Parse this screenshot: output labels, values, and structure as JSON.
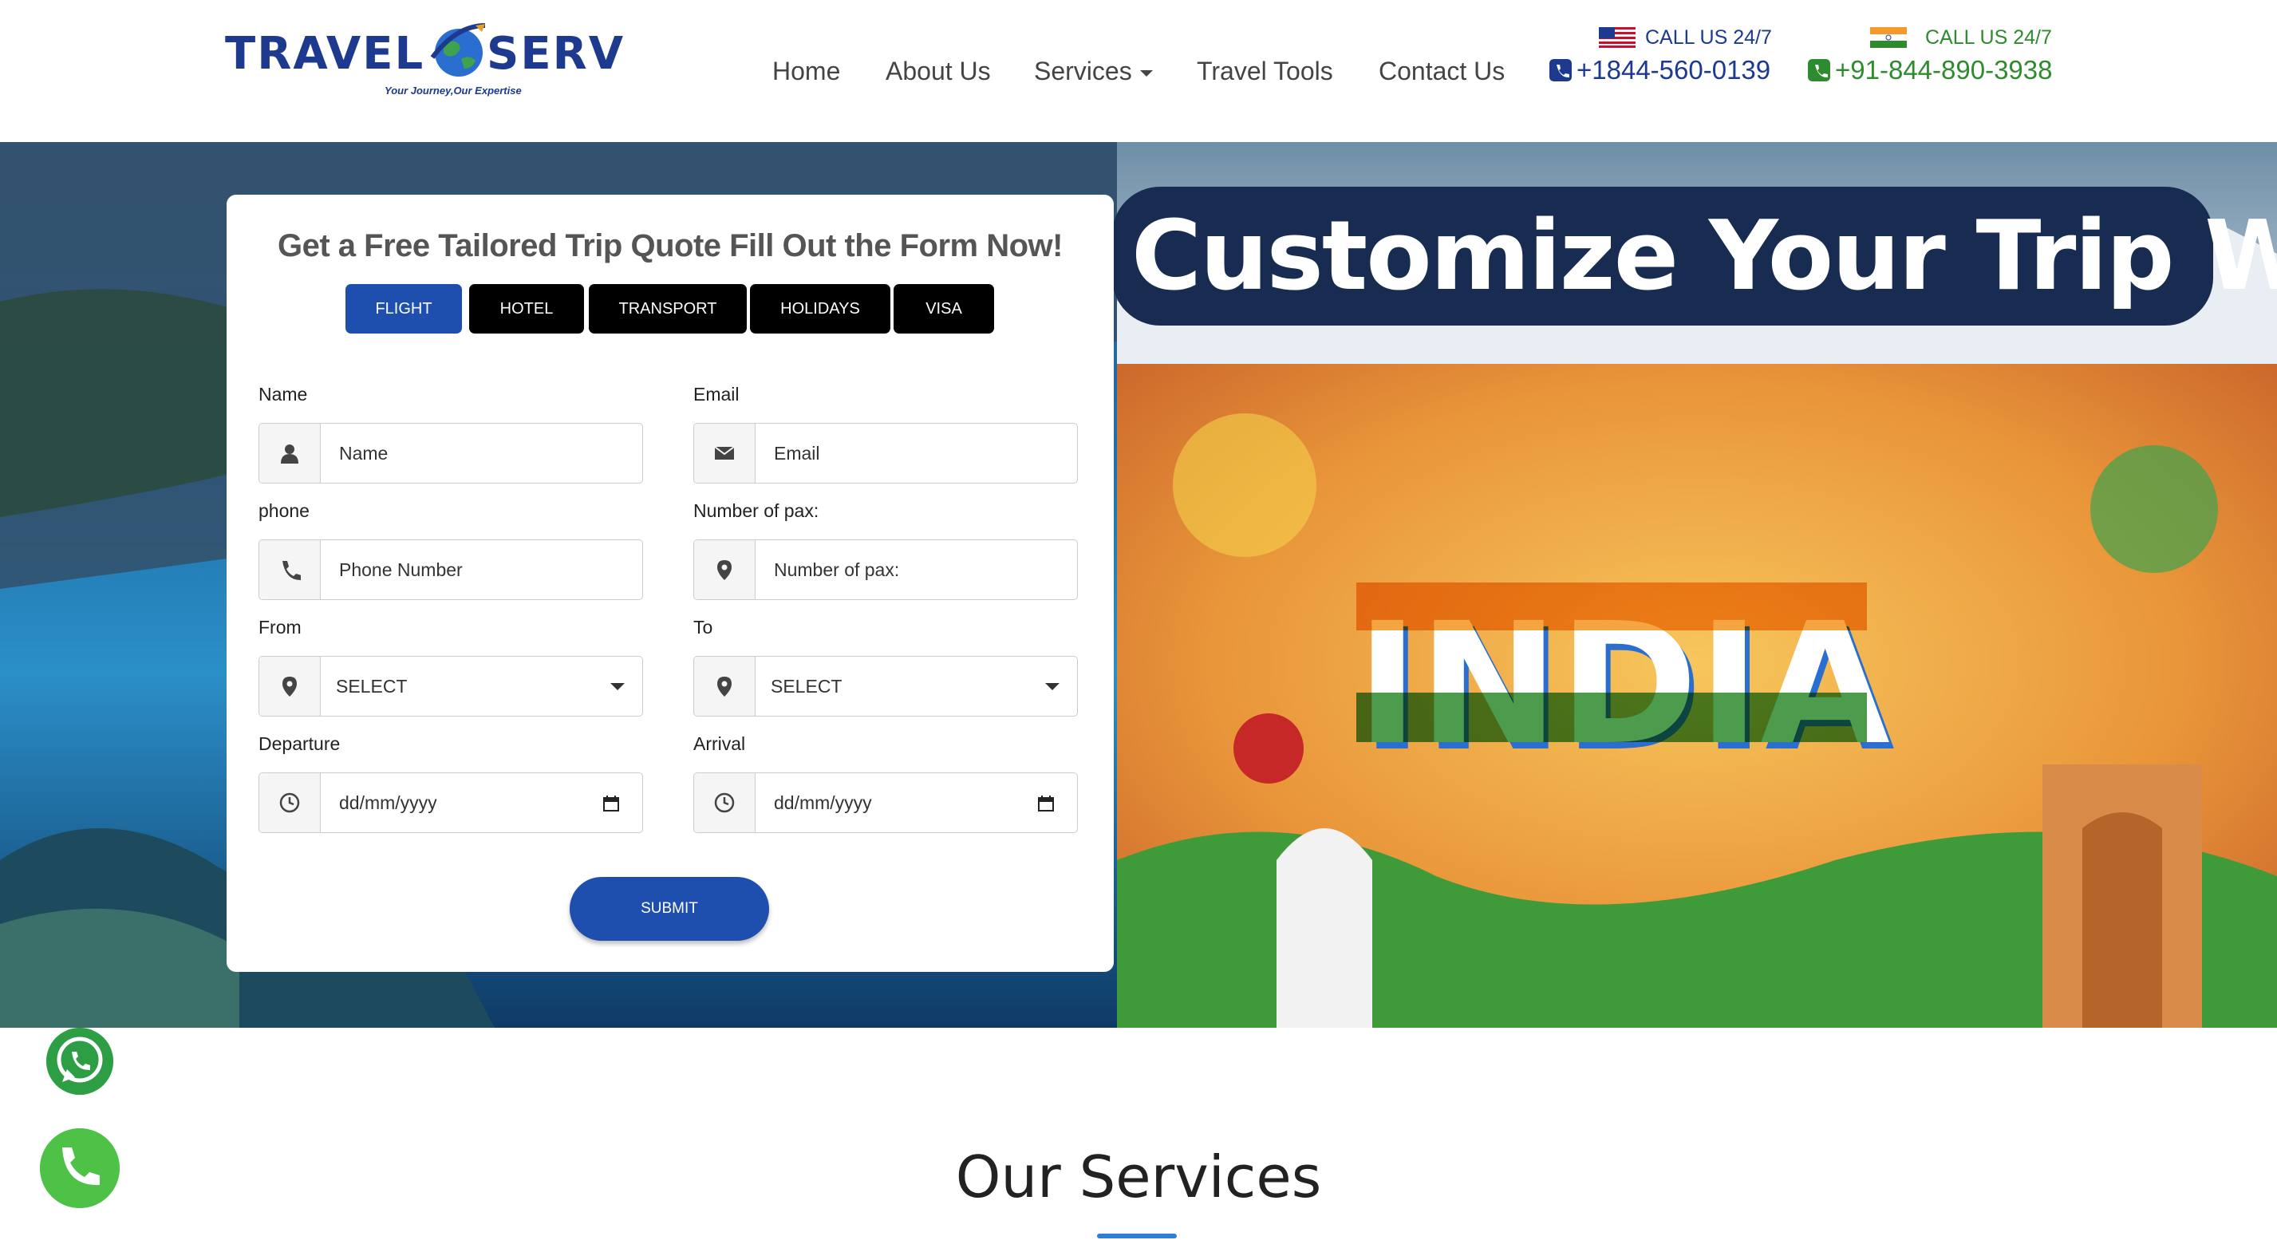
{
  "brand": {
    "name_left": "TRAVEL",
    "name_right": "SERV",
    "tagline": "Your Journey,Our Expertise",
    "primary_color": "#1d3a8f"
  },
  "nav": {
    "items": [
      {
        "label": "Home"
      },
      {
        "label": "About Us"
      },
      {
        "label": "Services"
      },
      {
        "label": "Travel Tools"
      },
      {
        "label": "Contact Us"
      }
    ]
  },
  "contacts": [
    {
      "flag": "us-flag-icon",
      "label": "CALL US 24/7",
      "number": "+1844-560-0139",
      "color": "#1d3a8f"
    },
    {
      "flag": "india-flag-icon",
      "label": "CALL US 24/7",
      "number": "+91-844-890-3938",
      "color": "#2e8b2e"
    }
  ],
  "hero": {
    "banner_title": "Customize Your Trip With Us",
    "banner_word": "INDIA"
  },
  "form": {
    "title": "Get a Free Tailored Trip Quote Fill Out the Form Now!",
    "tabs": [
      {
        "label": "FLIGHT",
        "active": true
      },
      {
        "label": "HOTEL",
        "active": false
      },
      {
        "label": "TRANSPORT",
        "active": false
      },
      {
        "label": "HOLIDAYS",
        "active": false
      },
      {
        "label": "VISA",
        "active": false
      }
    ],
    "fields": {
      "name": {
        "label": "Name",
        "placeholder": "Name",
        "icon": "user-icon"
      },
      "email": {
        "label": "Email",
        "placeholder": "Email",
        "icon": "envelope-icon"
      },
      "phone": {
        "label": "phone",
        "placeholder": "Phone Number",
        "icon": "phone-icon"
      },
      "pax": {
        "label": "Number of pax:",
        "placeholder": "Number of pax:",
        "icon": "location-pin-icon"
      },
      "from": {
        "label": "From",
        "value": "SELECT",
        "icon": "location-pin-icon"
      },
      "to": {
        "label": "To",
        "value": "SELECT",
        "icon": "location-pin-icon"
      },
      "departure": {
        "label": "Departure",
        "value": "dd/mm/yyyy",
        "icon": "clock-icon"
      },
      "arrival": {
        "label": "Arrival",
        "value": "dd/mm/yyyy",
        "icon": "clock-icon"
      }
    },
    "submit_label": "SUBMIT",
    "accent_color": "#1e4fae"
  },
  "services": {
    "title": "Our Services"
  },
  "floating": [
    {
      "icon": "whatsapp-icon"
    },
    {
      "icon": "call-icon"
    }
  ]
}
